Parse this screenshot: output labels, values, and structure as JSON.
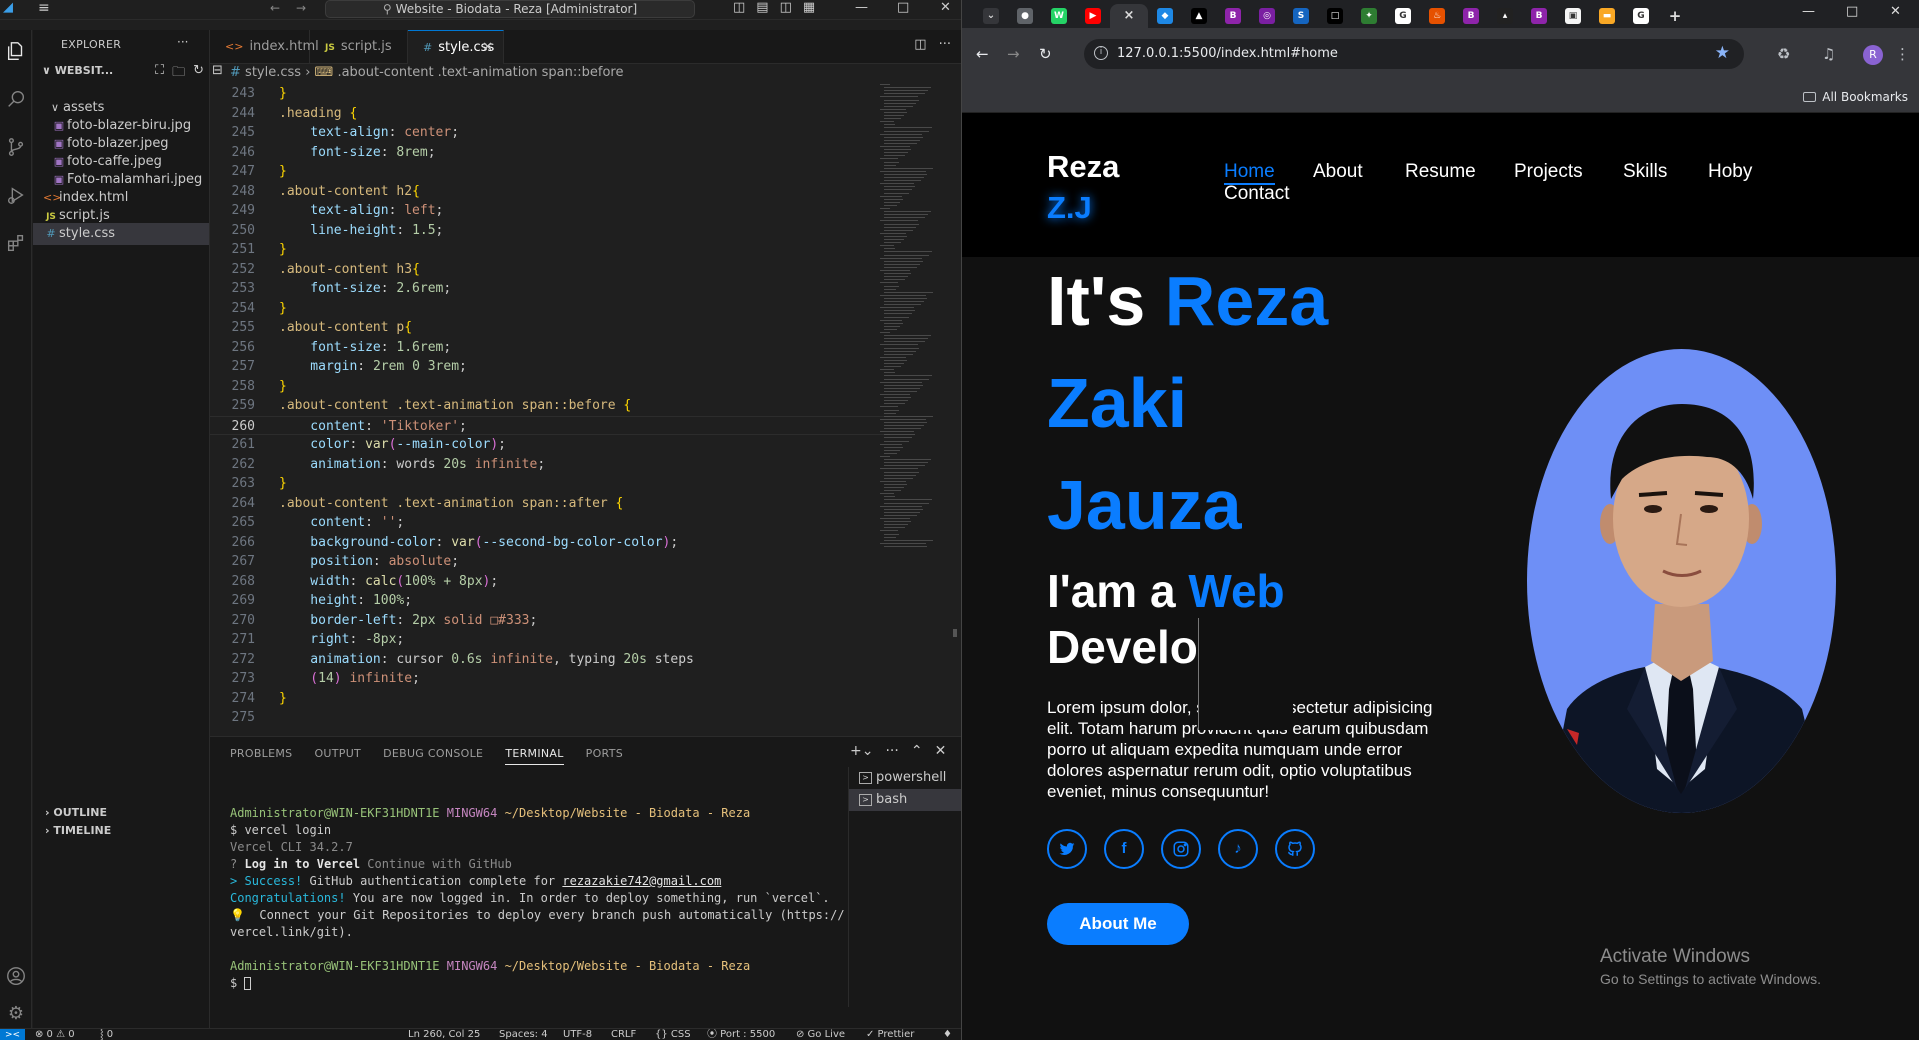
{
  "vscode": {
    "title_search": "Website - Biodata - Reza [Administrator]",
    "explorer_title": "EXPLORER",
    "folder_name": "WEBSIT...",
    "tree": [
      {
        "name": "assets",
        "type": "folder"
      },
      {
        "name": "foto-blazer-biru.jpg",
        "type": "img"
      },
      {
        "name": "foto-blazer.jpeg",
        "type": "img"
      },
      {
        "name": "foto-caffe.jpeg",
        "type": "img"
      },
      {
        "name": "Foto-malamhari.jpeg",
        "type": "img"
      },
      {
        "name": "index.html",
        "type": "html"
      },
      {
        "name": "script.js",
        "type": "js"
      },
      {
        "name": "style.css",
        "type": "css"
      }
    ],
    "outline_label": "OUTLINE",
    "timeline_label": "TIMELINE",
    "tabs": [
      {
        "label": "index.html"
      },
      {
        "label": "script.js"
      },
      {
        "label": "style.css"
      }
    ],
    "breadcrumb": {
      "file": "style.css",
      "selector": ".about-content .text-animation span::before"
    },
    "code_lines": [
      {
        "n": "243",
        "tokens": [
          {
            "t": "}",
            "c": "t-br2"
          }
        ]
      },
      {
        "n": "244",
        "tokens": [
          {
            "t": ".heading ",
            "c": "t-sel"
          },
          {
            "t": "{",
            "c": "t-br2"
          }
        ]
      },
      {
        "n": "245",
        "tokens": [
          {
            "t": "    text-align",
            "c": "t-prop"
          },
          {
            "t": ": ",
            "c": "t-punc"
          },
          {
            "t": "center",
            "c": "t-val"
          },
          {
            "t": ";",
            "c": "t-punc"
          }
        ]
      },
      {
        "n": "246",
        "tokens": [
          {
            "t": "    font-size",
            "c": "t-prop"
          },
          {
            "t": ": ",
            "c": "t-punc"
          },
          {
            "t": "8rem",
            "c": "t-num"
          },
          {
            "t": ";",
            "c": "t-punc"
          }
        ]
      },
      {
        "n": "247",
        "tokens": [
          {
            "t": "}",
            "c": "t-br2"
          }
        ]
      },
      {
        "n": "248",
        "tokens": [
          {
            "t": ".about-content h2",
            "c": "t-sel"
          },
          {
            "t": "{",
            "c": "t-br2"
          }
        ]
      },
      {
        "n": "249",
        "tokens": [
          {
            "t": "    text-align",
            "c": "t-prop"
          },
          {
            "t": ": ",
            "c": "t-punc"
          },
          {
            "t": "left",
            "c": "t-val"
          },
          {
            "t": ";",
            "c": "t-punc"
          }
        ]
      },
      {
        "n": "250",
        "tokens": [
          {
            "t": "    line-height",
            "c": "t-prop"
          },
          {
            "t": ": ",
            "c": "t-punc"
          },
          {
            "t": "1.5",
            "c": "t-num"
          },
          {
            "t": ";",
            "c": "t-punc"
          }
        ]
      },
      {
        "n": "251",
        "tokens": [
          {
            "t": "}",
            "c": "t-br2"
          }
        ]
      },
      {
        "n": "252",
        "tokens": [
          {
            "t": ".about-content h3",
            "c": "t-sel"
          },
          {
            "t": "{",
            "c": "t-br2"
          }
        ]
      },
      {
        "n": "253",
        "tokens": [
          {
            "t": "    font-size",
            "c": "t-prop"
          },
          {
            "t": ": ",
            "c": "t-punc"
          },
          {
            "t": "2.6rem",
            "c": "t-num"
          },
          {
            "t": ";",
            "c": "t-punc"
          }
        ]
      },
      {
        "n": "254",
        "tokens": [
          {
            "t": "}",
            "c": "t-br2"
          }
        ]
      },
      {
        "n": "255",
        "tokens": [
          {
            "t": ".about-content p",
            "c": "t-sel"
          },
          {
            "t": "{",
            "c": "t-br2"
          }
        ]
      },
      {
        "n": "256",
        "tokens": [
          {
            "t": "    font-size",
            "c": "t-prop"
          },
          {
            "t": ": ",
            "c": "t-punc"
          },
          {
            "t": "1.6rem",
            "c": "t-num"
          },
          {
            "t": ";",
            "c": "t-punc"
          }
        ]
      },
      {
        "n": "257",
        "tokens": [
          {
            "t": "    margin",
            "c": "t-prop"
          },
          {
            "t": ": ",
            "c": "t-punc"
          },
          {
            "t": "2rem 0 3rem",
            "c": "t-num"
          },
          {
            "t": ";",
            "c": "t-punc"
          }
        ]
      },
      {
        "n": "258",
        "tokens": [
          {
            "t": "}",
            "c": "t-br2"
          }
        ]
      },
      {
        "n": "259",
        "tokens": [
          {
            "t": ".about-content .text-animation span::before ",
            "c": "t-sel"
          },
          {
            "t": "{",
            "c": "t-br2"
          }
        ]
      },
      {
        "n": "260",
        "tokens": [
          {
            "t": "    content",
            "c": "t-prop"
          },
          {
            "t": ": ",
            "c": "t-punc"
          },
          {
            "t": "'Tiktoker'",
            "c": "t-val"
          },
          {
            "t": ";",
            "c": "t-punc"
          }
        ]
      },
      {
        "n": "261",
        "tokens": [
          {
            "t": "    color",
            "c": "t-prop"
          },
          {
            "t": ": ",
            "c": "t-punc"
          },
          {
            "t": "var",
            "c": "t-fn"
          },
          {
            "t": "(",
            "c": "t-br"
          },
          {
            "t": "--main-color",
            "c": "t-prop"
          },
          {
            "t": ")",
            "c": "t-br"
          },
          {
            "t": ";",
            "c": "t-punc"
          }
        ]
      },
      {
        "n": "262",
        "tokens": [
          {
            "t": "    animation",
            "c": "t-prop"
          },
          {
            "t": ": ",
            "c": "t-punc"
          },
          {
            "t": "words ",
            "c": "t-punc"
          },
          {
            "t": "20s ",
            "c": "t-num"
          },
          {
            "t": "infinite",
            "c": "t-val"
          },
          {
            "t": ";",
            "c": "t-punc"
          }
        ]
      },
      {
        "n": "263",
        "tokens": [
          {
            "t": "}",
            "c": "t-br2"
          }
        ]
      },
      {
        "n": "264",
        "tokens": [
          {
            "t": ".about-content .text-animation span::after ",
            "c": "t-sel"
          },
          {
            "t": "{",
            "c": "t-br2"
          }
        ]
      },
      {
        "n": "265",
        "tokens": [
          {
            "t": "    content",
            "c": "t-prop"
          },
          {
            "t": ": ",
            "c": "t-punc"
          },
          {
            "t": "''",
            "c": "t-val"
          },
          {
            "t": ";",
            "c": "t-punc"
          }
        ]
      },
      {
        "n": "266",
        "tokens": [
          {
            "t": "    background-color",
            "c": "t-prop"
          },
          {
            "t": ": ",
            "c": "t-punc"
          },
          {
            "t": "var",
            "c": "t-fn"
          },
          {
            "t": "(",
            "c": "t-br"
          },
          {
            "t": "--second-bg-color-color",
            "c": "t-prop"
          },
          {
            "t": ")",
            "c": "t-br"
          },
          {
            "t": ";",
            "c": "t-punc"
          }
        ]
      },
      {
        "n": "267",
        "tokens": [
          {
            "t": "    position",
            "c": "t-prop"
          },
          {
            "t": ": ",
            "c": "t-punc"
          },
          {
            "t": "absolute",
            "c": "t-val"
          },
          {
            "t": ";",
            "c": "t-punc"
          }
        ]
      },
      {
        "n": "268",
        "tokens": [
          {
            "t": "    width",
            "c": "t-prop"
          },
          {
            "t": ": ",
            "c": "t-punc"
          },
          {
            "t": "calc",
            "c": "t-fn"
          },
          {
            "t": "(",
            "c": "t-br"
          },
          {
            "t": "100% + 8px",
            "c": "t-num"
          },
          {
            "t": ")",
            "c": "t-br"
          },
          {
            "t": ";",
            "c": "t-punc"
          }
        ]
      },
      {
        "n": "269",
        "tokens": [
          {
            "t": "    height",
            "c": "t-prop"
          },
          {
            "t": ": ",
            "c": "t-punc"
          },
          {
            "t": "100%",
            "c": "t-num"
          },
          {
            "t": ";",
            "c": "t-punc"
          }
        ]
      },
      {
        "n": "270",
        "tokens": [
          {
            "t": "    border-left",
            "c": "t-prop"
          },
          {
            "t": ": ",
            "c": "t-punc"
          },
          {
            "t": "2px ",
            "c": "t-num"
          },
          {
            "t": "solid ",
            "c": "t-val"
          },
          {
            "t": "□#333",
            "c": "t-val"
          },
          {
            "t": ";",
            "c": "t-punc"
          }
        ]
      },
      {
        "n": "271",
        "tokens": [
          {
            "t": "    right",
            "c": "t-prop"
          },
          {
            "t": ": ",
            "c": "t-punc"
          },
          {
            "t": "-8px",
            "c": "t-num"
          },
          {
            "t": ";",
            "c": "t-punc"
          }
        ]
      },
      {
        "n": "272",
        "tokens": [
          {
            "t": "    animation",
            "c": "t-prop"
          },
          {
            "t": ": ",
            "c": "t-punc"
          },
          {
            "t": "cursor ",
            "c": "t-punc"
          },
          {
            "t": "0.6s ",
            "c": "t-num"
          },
          {
            "t": "infinite",
            "c": "t-val"
          },
          {
            "t": ", typing ",
            "c": "t-punc"
          },
          {
            "t": "20s ",
            "c": "t-num"
          },
          {
            "t": "steps",
            "c": "t-punc"
          }
        ]
      },
      {
        "n": "273",
        "tokens": [
          {
            "t": "    (",
            "c": "t-br"
          },
          {
            "t": "14",
            "c": "t-num"
          },
          {
            "t": ") ",
            "c": "t-br"
          },
          {
            "t": "infinite",
            "c": "t-val"
          },
          {
            "t": ";",
            "c": "t-punc"
          }
        ]
      },
      {
        "n": "274",
        "tokens": [
          {
            "t": "}",
            "c": "t-br2"
          }
        ]
      },
      {
        "n": "275",
        "tokens": []
      }
    ],
    "current_line": "260",
    "panel_tabs": [
      "PROBLEMS",
      "OUTPUT",
      "DEBUG CONSOLE",
      "TERMINAL",
      "PORTS"
    ],
    "terminal_list": [
      "powershell",
      "bash"
    ],
    "terminal": {
      "prompt_user": "Administrator@WIN-EKF31HDNT1E",
      "prompt_shell": "MINGW64",
      "prompt_path": "~/Desktop/Website - Biodata - Reza",
      "cmd1": "$ vercel login",
      "cli_version": "Vercel CLI 34.2.7",
      "q_mark": "?",
      "q_bold": "Log in to Vercel",
      "q_rest": "Continue with GitHub",
      "succ_mark": ">",
      "succ_word": "Success!",
      "succ_rest": "GitHub authentication complete for",
      "email": "rezazakie742@gmail.com",
      "congrats": "Congratulations!",
      "congrats_rest": "You are now logged in. In order to deploy something, run `vercel`.",
      "tip": "💡  Connect your Git Repositories to deploy every branch push automatically (https://",
      "tip2": "vercel.link/git).",
      "prompt2_end": "$"
    },
    "status": {
      "errors": "⊗ 0 ⚠ 0",
      "ports": "⸾ 0",
      "position": "Ln 260, Col 25",
      "spaces": "Spaces: 4",
      "encoding": "UTF-8",
      "eol": "CRLF",
      "language": "{} CSS",
      "port": "⦿ Port : 5500",
      "golive": "⊘ Go Live",
      "prettier": "✓ Prettier"
    }
  },
  "chrome": {
    "url": "127.0.0.1:5500/index.html#home",
    "all_bookmarks": "All Bookmarks",
    "avatar_letter": "R",
    "tab_icons": [
      {
        "label": "●",
        "bg": "#5f6368"
      },
      {
        "label": "W",
        "bg": "#25d366"
      },
      {
        "label": "▶",
        "bg": "#ff0000"
      },
      {
        "label": "×",
        "bg": "active"
      },
      {
        "label": "◆",
        "bg": "#1e88e5"
      },
      {
        "label": "▲",
        "bg": "#000000"
      },
      {
        "label": "B",
        "bg": "#8e24aa"
      },
      {
        "label": "◎",
        "bg": "#7b1fa2"
      },
      {
        "label": "S",
        "bg": "#1565c0"
      },
      {
        "label": "□",
        "bg": "#000000"
      },
      {
        "label": "✦",
        "bg": "#2e7d32"
      },
      {
        "label": "G",
        "bg": "#ffffff"
      },
      {
        "label": "♨",
        "bg": "#e65100"
      },
      {
        "label": "B",
        "bg": "#8e24aa"
      },
      {
        "label": "▴",
        "bg": "#212121"
      },
      {
        "label": "B",
        "bg": "#8e24aa"
      },
      {
        "label": "▣",
        "bg": "#f5f5f5"
      },
      {
        "label": "▬",
        "bg": "#f9a825"
      },
      {
        "label": "G",
        "bg": "#ffffff"
      }
    ],
    "site": {
      "logo_top": "Reza",
      "logo_bottom": "Z.J",
      "nav": [
        "Home",
        "About",
        "Resume",
        "Projects",
        "Skills",
        "Hoby",
        "Contact"
      ],
      "hero_prefix": "It's ",
      "hero_name1": "Reza",
      "hero_name2": "Zaki",
      "hero_name3": "Jauza",
      "sub_prefix": "I'am a ",
      "sub_word1": "Web",
      "sub_word2": "Develo",
      "paragraph": "Lorem ipsum dolor, sit amet consectetur adipisicing elit. Totam harum provident quis earum quibusdam porro ut aliquam expedita numquam unde error dolores aspernatur rerum odit, optio voluptatibus eveniet, minus consequuntur!",
      "socials": [
        "twitter-icon",
        "facebook-icon",
        "instagram-icon",
        "tiktok-icon",
        "github-icon"
      ],
      "about_btn": "About Me"
    },
    "watermark": {
      "title": "Activate Windows",
      "subtitle": "Go to Settings to activate Windows."
    }
  },
  "colors": {
    "accent": "#0a7dff",
    "vscode_blue": "#0078d4"
  }
}
